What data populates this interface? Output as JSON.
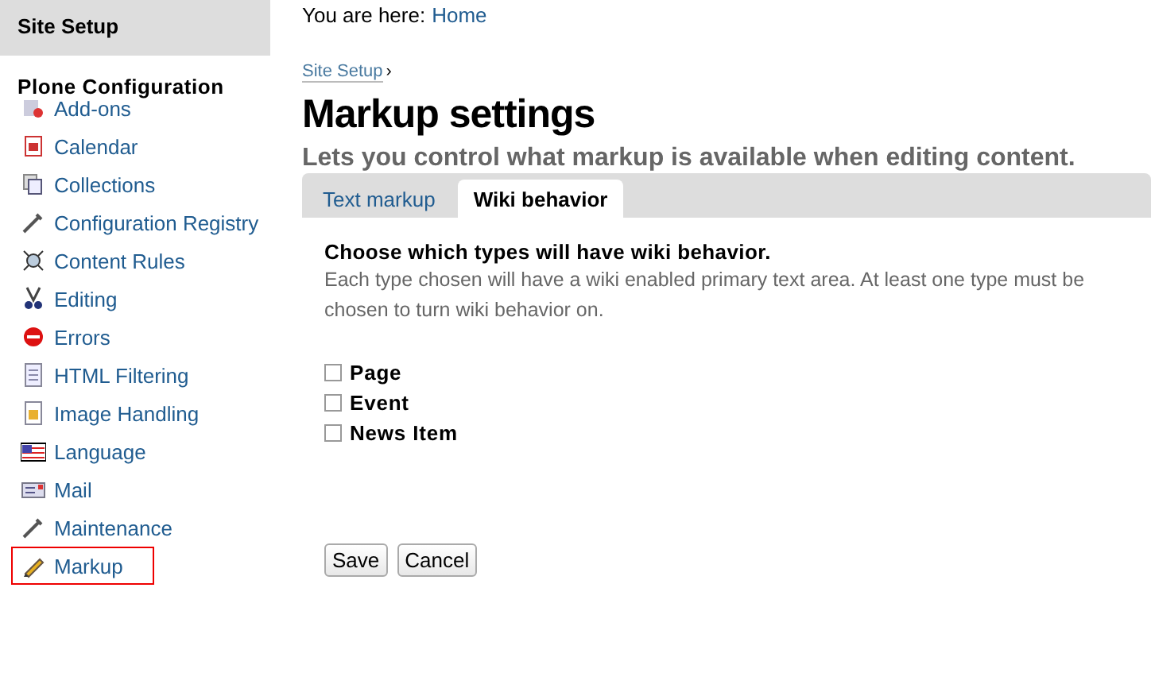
{
  "sidebar": {
    "title": "Site Setup",
    "section": "Plone Configuration",
    "items": [
      {
        "label": "Add-ons",
        "selected": false
      },
      {
        "label": "Calendar",
        "selected": false
      },
      {
        "label": "Collections",
        "selected": false
      },
      {
        "label": "Configuration Registry",
        "selected": false
      },
      {
        "label": "Content Rules",
        "selected": false
      },
      {
        "label": "Editing",
        "selected": false
      },
      {
        "label": "Errors",
        "selected": false
      },
      {
        "label": "HTML Filtering",
        "selected": false
      },
      {
        "label": "Image Handling",
        "selected": false
      },
      {
        "label": "Language",
        "selected": false
      },
      {
        "label": "Mail",
        "selected": false
      },
      {
        "label": "Maintenance",
        "selected": false
      },
      {
        "label": "Markup",
        "selected": true
      }
    ]
  },
  "location": {
    "prefix": "You are here:",
    "link": "Home"
  },
  "breadcrumb": {
    "link": "Site Setup",
    "separator": "›"
  },
  "title": "Markup settings",
  "description": "Lets you control what markup is available when editing content.",
  "tabs": [
    {
      "label": "Text markup",
      "selected": false
    },
    {
      "label": "Wiki behavior",
      "selected": true
    }
  ],
  "field": {
    "label": "Choose which types will have wiki behavior.",
    "help": "Each type chosen will have a wiki enabled primary text area. At least one type must be chosen to turn wiki behavior on.",
    "options": [
      {
        "label": "Page",
        "checked": false
      },
      {
        "label": "Event",
        "checked": false
      },
      {
        "label": "News Item",
        "checked": false
      }
    ]
  },
  "buttons": [
    "Save",
    "Cancel"
  ]
}
